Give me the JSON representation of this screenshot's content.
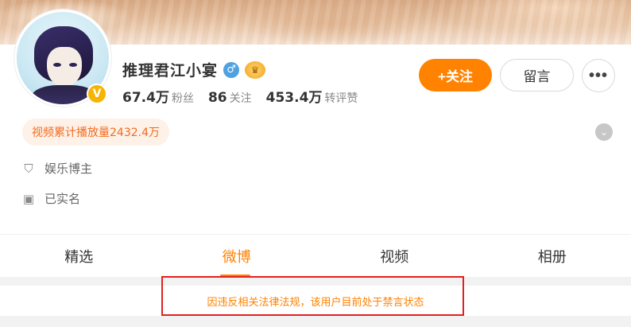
{
  "profile": {
    "name": "推理君江小宴",
    "gender_symbol": "♂",
    "crown_symbol": "♛",
    "avatar_badge_symbol": "V",
    "stats": [
      {
        "value": "67.4万",
        "label": "粉丝"
      },
      {
        "value": "86",
        "label": "关注"
      },
      {
        "value": "453.4万",
        "label": "转评赞"
      }
    ],
    "video_badge": "视频累计播放量2432.4万",
    "category": "娱乐博主",
    "verification": "已实名"
  },
  "actions": {
    "follow": "+关注",
    "message": "留言",
    "more": "•••"
  },
  "icons": {
    "expand": "⌄",
    "shield": "⛉",
    "idcard": "▣"
  },
  "tabs": [
    {
      "label": "精选"
    },
    {
      "label": "微博"
    },
    {
      "label": "视频"
    },
    {
      "label": "相册"
    }
  ],
  "notice": "因违反相关法律法规，该用户目前处于禁言状态",
  "colors": {
    "accent": "#ff8200",
    "warning_box": "#e32020"
  }
}
